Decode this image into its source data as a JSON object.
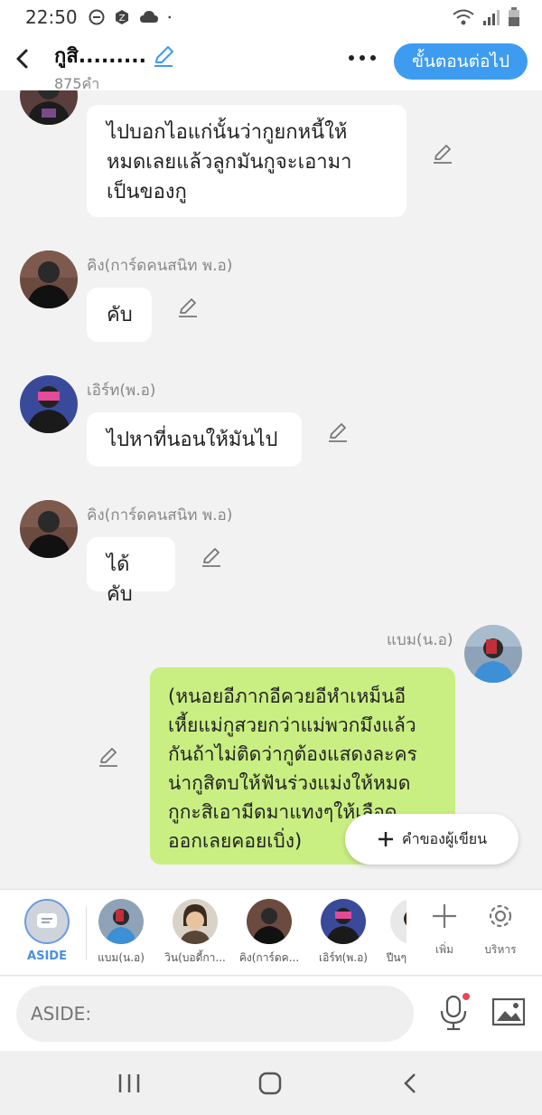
{
  "status": {
    "time": "22:50"
  },
  "header": {
    "title": "กูสิ.........",
    "count": "875คำ",
    "next_button": "ขั้นตอนต่อไป"
  },
  "messages": [
    {
      "sender": "",
      "text_lines": [
        "ไปบอกไอแก่นั้นว่ากูยกหนี้ให้",
        "หมดเลยแล้วลูกมันกูจะเอามา",
        "เป็นของกู"
      ]
    },
    {
      "sender": "คิง(การ์ดคนสนิท พ.อ)",
      "text_lines": [
        "คับ"
      ]
    },
    {
      "sender": "เอิร์ท(พ.อ)",
      "text_lines": [
        "ไปหาที่นอนให้มันไป"
      ]
    },
    {
      "sender": "คิง(การ์ดคนสนิท พ.อ)",
      "text_lines": [
        "ได้คับ"
      ]
    },
    {
      "sender": "แบม(น.อ)",
      "text_lines": [
        "(หนอยอีภากอีควยอีหำเหม็นอี",
        "เหี้ยแม่กูสวยกว่าแม่พวกมึงแล้ว",
        "กันถ้าไม่ติดว่ากูต้องแสดงละคร",
        "น่ากูสิตบให้ฟันร่วงแม่งให้หมด",
        "กูกะสิเอามีดมาแทงๆให้เลือด",
        "ออกเลยคอยเบิ่ง)"
      ]
    }
  ],
  "fab": {
    "label": "คำของผู้เขียน"
  },
  "characters": {
    "aside_label": "ASIDE",
    "items": [
      "แบม(น.อ)",
      "วิน(บอดี้กา...",
      "คิง(การ์ดค...",
      "เอิร์ท(พ.อ)",
      "ปีนๆ"
    ]
  },
  "tools": {
    "add_label": "เพิ่ม",
    "manage_label": "บริหาร"
  },
  "input": {
    "placeholder": "ASIDE:"
  },
  "colors": {
    "accent": "#3d9cf0",
    "bubble_self": "#c9ee82",
    "bubble_other": "#ffffff"
  }
}
